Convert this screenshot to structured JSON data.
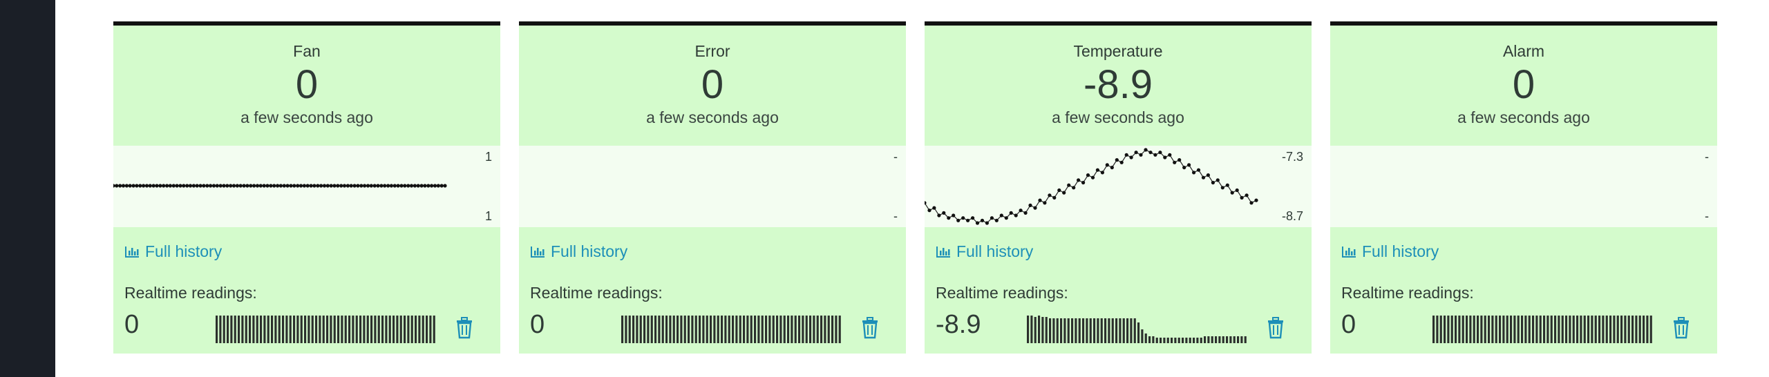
{
  "cards": [
    {
      "title": "Fan",
      "value": "0",
      "updated": "a few seconds ago",
      "range_max": "1",
      "range_min": "1",
      "history_label": "Full history",
      "realtime_label": "Realtime readings:",
      "realtime_value": "0",
      "series": [
        1,
        1,
        1,
        1,
        1,
        1,
        1,
        1,
        1,
        1,
        1,
        1,
        1,
        1,
        1,
        1,
        1,
        1,
        1,
        1,
        1,
        1,
        1,
        1,
        1,
        1,
        1,
        1,
        1,
        1,
        1,
        1,
        1,
        1,
        1,
        1,
        1,
        1,
        1,
        1,
        1,
        1,
        1,
        1,
        1,
        1,
        1,
        1,
        1,
        1,
        1,
        1,
        1,
        1,
        1,
        1,
        1,
        1,
        1,
        1,
        1,
        1,
        1,
        1,
        1,
        1,
        1,
        1,
        1,
        1,
        1,
        1,
        1,
        1,
        1,
        1,
        1,
        1,
        1,
        1,
        1,
        1,
        1,
        1,
        1,
        1,
        1,
        1,
        1,
        1,
        1,
        1,
        1,
        1,
        1,
        1,
        1,
        1,
        1,
        1
      ],
      "readings": [
        1,
        1,
        1,
        1,
        1,
        1,
        1,
        1,
        1,
        1,
        1,
        1,
        1,
        1,
        1,
        1,
        1,
        1,
        1,
        1,
        1,
        1,
        1,
        1,
        1,
        1,
        1,
        1,
        1,
        1,
        1,
        1,
        1,
        1,
        1,
        1,
        1,
        1,
        1,
        1,
        1,
        1,
        1,
        1,
        1,
        1,
        1,
        1,
        1,
        1,
        1,
        1,
        1,
        1,
        1,
        1,
        1,
        1,
        1,
        1
      ]
    },
    {
      "title": "Error",
      "value": "0",
      "updated": "a few seconds ago",
      "range_max": "-",
      "range_min": "-",
      "history_label": "Full history",
      "realtime_label": "Realtime readings:",
      "realtime_value": "0",
      "series": [],
      "readings": [
        1,
        1,
        1,
        1,
        1,
        1,
        1,
        1,
        1,
        1,
        1,
        1,
        1,
        1,
        1,
        1,
        1,
        1,
        1,
        1,
        1,
        1,
        1,
        1,
        1,
        1,
        1,
        1,
        1,
        1,
        1,
        1,
        1,
        1,
        1,
        1,
        1,
        1,
        1,
        1,
        1,
        1,
        1,
        1,
        1,
        1,
        1,
        1,
        1,
        1,
        1,
        1,
        1,
        1,
        1,
        1,
        1,
        1,
        1,
        1
      ]
    },
    {
      "title": "Temperature",
      "value": "-8.9",
      "updated": "a few seconds ago",
      "range_max": "-7.3",
      "range_min": "-8.7",
      "history_label": "Full history",
      "realtime_label": "Realtime readings:",
      "realtime_value": "-8.9",
      "series": [
        -8.3,
        -8.45,
        -8.4,
        -8.55,
        -8.5,
        -8.6,
        -8.55,
        -8.65,
        -8.6,
        -8.65,
        -8.6,
        -8.7,
        -8.65,
        -8.7,
        -8.6,
        -8.65,
        -8.55,
        -8.6,
        -8.5,
        -8.55,
        -8.45,
        -8.5,
        -8.35,
        -8.4,
        -8.25,
        -8.3,
        -8.15,
        -8.2,
        -8.05,
        -8.1,
        -7.95,
        -8.0,
        -7.85,
        -7.9,
        -7.75,
        -7.8,
        -7.65,
        -7.7,
        -7.55,
        -7.6,
        -7.45,
        -7.5,
        -7.35,
        -7.4,
        -7.3,
        -7.35,
        -7.25,
        -7.3,
        -7.35,
        -7.3,
        -7.4,
        -7.35,
        -7.5,
        -7.45,
        -7.6,
        -7.55,
        -7.7,
        -7.65,
        -7.8,
        -7.75,
        -7.9,
        -7.85,
        -8.0,
        -7.95,
        -8.1,
        -8.05,
        -8.2,
        -8.15,
        -8.3,
        -8.25
      ],
      "readings": [
        1,
        1,
        0.95,
        1,
        0.95,
        0.95,
        0.9,
        0.9,
        0.9,
        0.9,
        0.9,
        0.9,
        0.9,
        0.9,
        0.9,
        0.9,
        0.9,
        0.9,
        0.9,
        0.9,
        0.9,
        0.9,
        0.9,
        0.9,
        0.9,
        0.9,
        0.9,
        0.9,
        0.9,
        0.9,
        0.75,
        0.5,
        0.35,
        0.25,
        0.25,
        0.2,
        0.2,
        0.2,
        0.2,
        0.2,
        0.2,
        0.2,
        0.2,
        0.2,
        0.2,
        0.2,
        0.2,
        0.2,
        0.25,
        0.25,
        0.25,
        0.25,
        0.25,
        0.25,
        0.25,
        0.25,
        0.25,
        0.25,
        0.25,
        0.25
      ]
    },
    {
      "title": "Alarm",
      "value": "0",
      "updated": "a few seconds ago",
      "range_max": "-",
      "range_min": "-",
      "history_label": "Full history",
      "realtime_label": "Realtime readings:",
      "realtime_value": "0",
      "series": [],
      "readings": [
        1,
        1,
        1,
        1,
        1,
        1,
        1,
        1,
        1,
        1,
        1,
        1,
        1,
        1,
        1,
        1,
        1,
        1,
        1,
        1,
        1,
        1,
        1,
        1,
        1,
        1,
        1,
        1,
        1,
        1,
        1,
        1,
        1,
        1,
        1,
        1,
        1,
        1,
        1,
        1,
        1,
        1,
        1,
        1,
        1,
        1,
        1,
        1,
        1,
        1,
        1,
        1,
        1,
        1,
        1,
        1,
        1,
        1,
        1,
        1
      ]
    }
  ],
  "colors": {
    "card_bg": "#d4fbcc",
    "spark_bg": "#f3fdf1",
    "link": "#1d8fb8",
    "sidebar": "#1b1f27"
  },
  "icons": {
    "history": "bar-chart-icon",
    "delete": "trash-icon"
  }
}
